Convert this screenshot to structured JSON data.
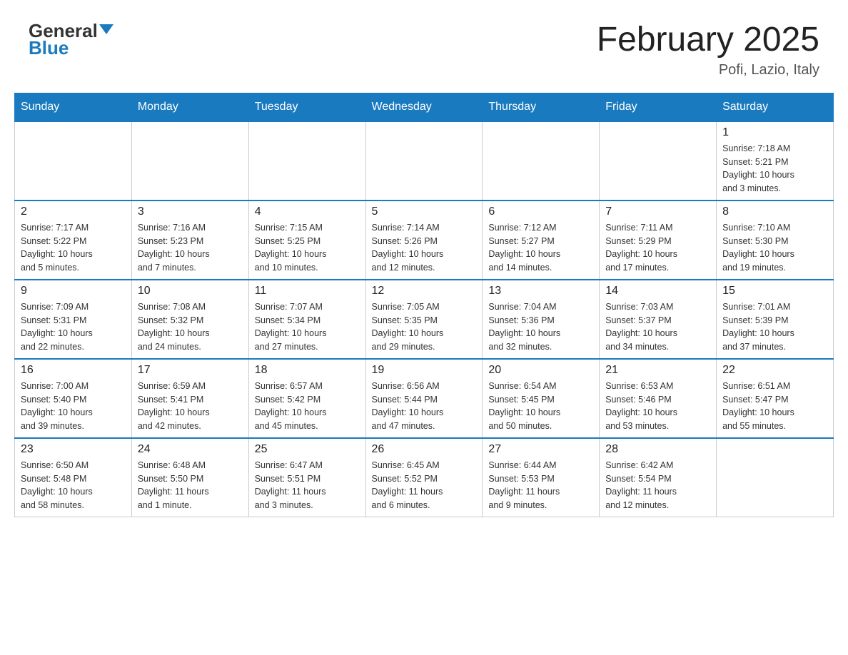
{
  "header": {
    "logo_general": "General",
    "logo_blue": "Blue",
    "title": "February 2025",
    "subtitle": "Pofi, Lazio, Italy"
  },
  "weekdays": [
    "Sunday",
    "Monday",
    "Tuesday",
    "Wednesday",
    "Thursday",
    "Friday",
    "Saturday"
  ],
  "weeks": [
    [
      {
        "day": "",
        "info": ""
      },
      {
        "day": "",
        "info": ""
      },
      {
        "day": "",
        "info": ""
      },
      {
        "day": "",
        "info": ""
      },
      {
        "day": "",
        "info": ""
      },
      {
        "day": "",
        "info": ""
      },
      {
        "day": "1",
        "info": "Sunrise: 7:18 AM\nSunset: 5:21 PM\nDaylight: 10 hours\nand 3 minutes."
      }
    ],
    [
      {
        "day": "2",
        "info": "Sunrise: 7:17 AM\nSunset: 5:22 PM\nDaylight: 10 hours\nand 5 minutes."
      },
      {
        "day": "3",
        "info": "Sunrise: 7:16 AM\nSunset: 5:23 PM\nDaylight: 10 hours\nand 7 minutes."
      },
      {
        "day": "4",
        "info": "Sunrise: 7:15 AM\nSunset: 5:25 PM\nDaylight: 10 hours\nand 10 minutes."
      },
      {
        "day": "5",
        "info": "Sunrise: 7:14 AM\nSunset: 5:26 PM\nDaylight: 10 hours\nand 12 minutes."
      },
      {
        "day": "6",
        "info": "Sunrise: 7:12 AM\nSunset: 5:27 PM\nDaylight: 10 hours\nand 14 minutes."
      },
      {
        "day": "7",
        "info": "Sunrise: 7:11 AM\nSunset: 5:29 PM\nDaylight: 10 hours\nand 17 minutes."
      },
      {
        "day": "8",
        "info": "Sunrise: 7:10 AM\nSunset: 5:30 PM\nDaylight: 10 hours\nand 19 minutes."
      }
    ],
    [
      {
        "day": "9",
        "info": "Sunrise: 7:09 AM\nSunset: 5:31 PM\nDaylight: 10 hours\nand 22 minutes."
      },
      {
        "day": "10",
        "info": "Sunrise: 7:08 AM\nSunset: 5:32 PM\nDaylight: 10 hours\nand 24 minutes."
      },
      {
        "day": "11",
        "info": "Sunrise: 7:07 AM\nSunset: 5:34 PM\nDaylight: 10 hours\nand 27 minutes."
      },
      {
        "day": "12",
        "info": "Sunrise: 7:05 AM\nSunset: 5:35 PM\nDaylight: 10 hours\nand 29 minutes."
      },
      {
        "day": "13",
        "info": "Sunrise: 7:04 AM\nSunset: 5:36 PM\nDaylight: 10 hours\nand 32 minutes."
      },
      {
        "day": "14",
        "info": "Sunrise: 7:03 AM\nSunset: 5:37 PM\nDaylight: 10 hours\nand 34 minutes."
      },
      {
        "day": "15",
        "info": "Sunrise: 7:01 AM\nSunset: 5:39 PM\nDaylight: 10 hours\nand 37 minutes."
      }
    ],
    [
      {
        "day": "16",
        "info": "Sunrise: 7:00 AM\nSunset: 5:40 PM\nDaylight: 10 hours\nand 39 minutes."
      },
      {
        "day": "17",
        "info": "Sunrise: 6:59 AM\nSunset: 5:41 PM\nDaylight: 10 hours\nand 42 minutes."
      },
      {
        "day": "18",
        "info": "Sunrise: 6:57 AM\nSunset: 5:42 PM\nDaylight: 10 hours\nand 45 minutes."
      },
      {
        "day": "19",
        "info": "Sunrise: 6:56 AM\nSunset: 5:44 PM\nDaylight: 10 hours\nand 47 minutes."
      },
      {
        "day": "20",
        "info": "Sunrise: 6:54 AM\nSunset: 5:45 PM\nDaylight: 10 hours\nand 50 minutes."
      },
      {
        "day": "21",
        "info": "Sunrise: 6:53 AM\nSunset: 5:46 PM\nDaylight: 10 hours\nand 53 minutes."
      },
      {
        "day": "22",
        "info": "Sunrise: 6:51 AM\nSunset: 5:47 PM\nDaylight: 10 hours\nand 55 minutes."
      }
    ],
    [
      {
        "day": "23",
        "info": "Sunrise: 6:50 AM\nSunset: 5:48 PM\nDaylight: 10 hours\nand 58 minutes."
      },
      {
        "day": "24",
        "info": "Sunrise: 6:48 AM\nSunset: 5:50 PM\nDaylight: 11 hours\nand 1 minute."
      },
      {
        "day": "25",
        "info": "Sunrise: 6:47 AM\nSunset: 5:51 PM\nDaylight: 11 hours\nand 3 minutes."
      },
      {
        "day": "26",
        "info": "Sunrise: 6:45 AM\nSunset: 5:52 PM\nDaylight: 11 hours\nand 6 minutes."
      },
      {
        "day": "27",
        "info": "Sunrise: 6:44 AM\nSunset: 5:53 PM\nDaylight: 11 hours\nand 9 minutes."
      },
      {
        "day": "28",
        "info": "Sunrise: 6:42 AM\nSunset: 5:54 PM\nDaylight: 11 hours\nand 12 minutes."
      },
      {
        "day": "",
        "info": ""
      }
    ]
  ]
}
